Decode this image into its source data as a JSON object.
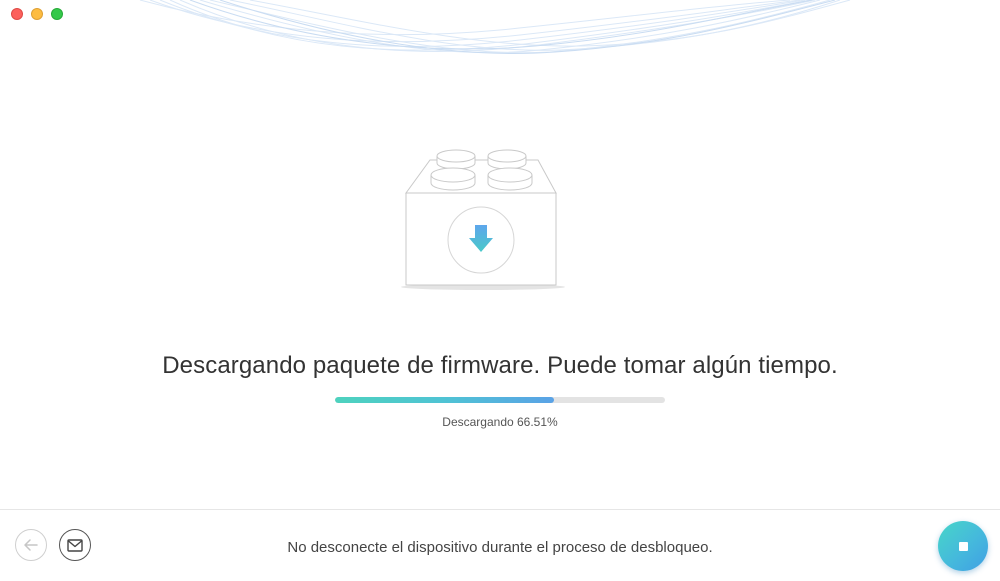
{
  "window": {
    "controls": [
      "close",
      "minimize",
      "zoom"
    ]
  },
  "main": {
    "icon": "firmware-package-download-icon",
    "headline": "Descargando paquete de firmware. Puede tomar algún tiempo.",
    "progress": {
      "percent": 66.51,
      "status_text": "Descargando 66.51%"
    }
  },
  "footer": {
    "note": "No desconecte el dispositivo durante el proceso de desbloqueo.",
    "back_icon": "arrow-left-icon",
    "mail_icon": "mail-icon",
    "stop_icon": "stop-icon"
  },
  "colors": {
    "progress_start": "#4ed2be",
    "progress_end": "#5aa2e6",
    "accent": "#45b9dc",
    "track": "#e3e3e3"
  }
}
